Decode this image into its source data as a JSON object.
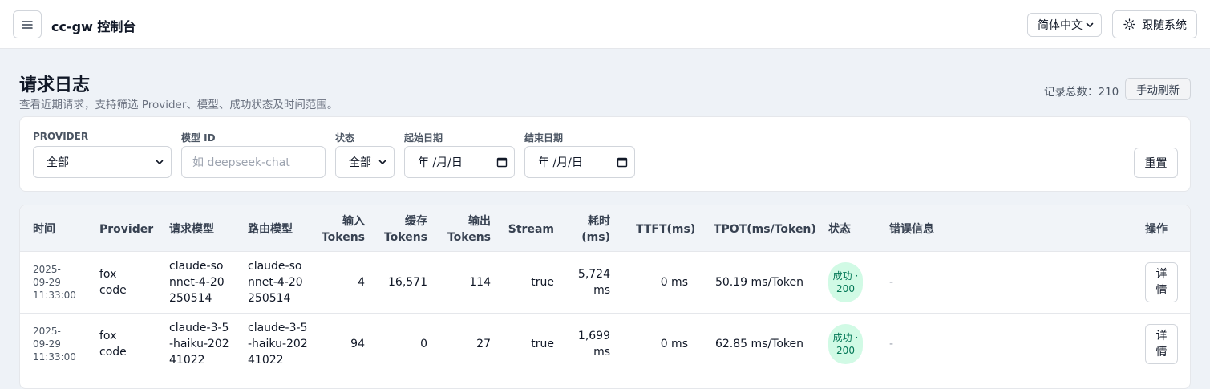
{
  "topbar": {
    "app_title": "cc-gw 控制台",
    "language": "简体中文",
    "theme_label": "跟随系统"
  },
  "header": {
    "title": "请求日志",
    "subtitle": "查看近期请求，支持筛选 Provider、模型、成功状态及时间范围。",
    "total_label": "记录总数：210",
    "refresh_label": "手动刷新"
  },
  "filters": {
    "provider_label": "PROVIDER",
    "provider_value": "全部",
    "model_label": "模型 ID",
    "model_placeholder": "如 deepseek-chat",
    "status_label": "状态",
    "status_value": "全部",
    "start_label": "起始日期",
    "start_value": "年 /月/日",
    "end_label": "结束日期",
    "end_value": "年 /月/日",
    "reset_label": "重置"
  },
  "table": {
    "columns": [
      "时间",
      "Provider",
      "请求模型",
      "路由模型",
      "输入Tokens",
      "缓存Tokens",
      "输出Tokens",
      "Stream",
      "耗时(ms)",
      "TTFT(ms)",
      "TPOT(ms/Token)",
      "状态",
      "错误信息",
      "操作"
    ],
    "rows": [
      {
        "time": "2025-09-29 11:33:00",
        "provider": "fox code",
        "request_model": "claude-sonnet-4-20250514",
        "route_model": "claude-sonnet-4-20250514",
        "input_tokens": "4",
        "cache_tokens": "16,571",
        "output_tokens": "114",
        "stream": "true",
        "latency": "5,724 ms",
        "ttft": "0 ms",
        "tpot": "50.19 ms/Token",
        "status": "成功 · 200",
        "error": "-",
        "action": "详情"
      },
      {
        "time": "2025-09-29 11:33:00",
        "provider": "fox code",
        "request_model": "claude-3-5-haiku-20241022",
        "route_model": "claude-3-5-haiku-20241022",
        "input_tokens": "94",
        "cache_tokens": "0",
        "output_tokens": "27",
        "stream": "true",
        "latency": "1,699 ms",
        "ttft": "0 ms",
        "tpot": "62.85 ms/Token",
        "status": "成功 · 200",
        "error": "-",
        "action": "详情"
      }
    ]
  },
  "colors": {
    "accent_success_bg": "#d1fae5",
    "accent_success_text": "#047857",
    "page_bg": "#eef2f7"
  }
}
